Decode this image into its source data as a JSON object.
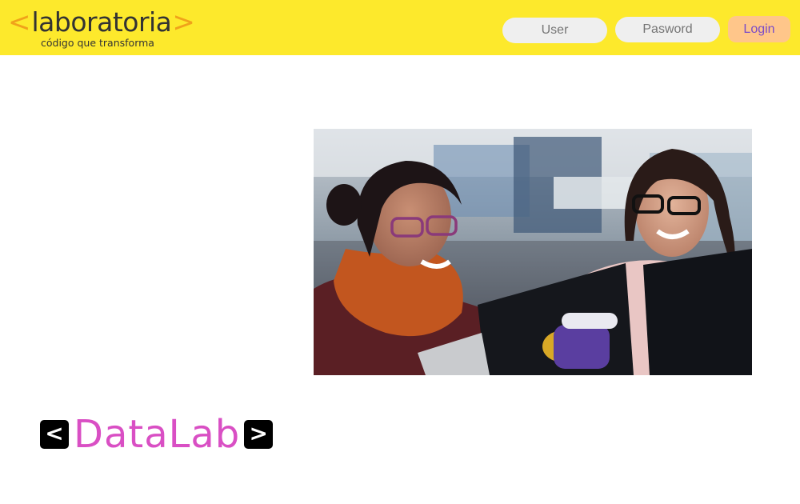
{
  "header": {
    "logo": {
      "bracket_open": "<",
      "wordmark": "laboratoria",
      "bracket_close": ">",
      "tagline": "código que transforma"
    },
    "login_form": {
      "user_placeholder": "User",
      "password_placeholder": "Pasword",
      "login_label": "Login"
    }
  },
  "hero": {
    "description": "photo"
  },
  "brand": {
    "prev_arrow": "<",
    "title": "DataLab",
    "next_arrow": ">"
  },
  "colors": {
    "header_bg": "#fde92c",
    "bracket": "#f0a21a",
    "login_bg": "#ffc68a",
    "login_text": "#7a4bc8",
    "datalab": "#d94fc4"
  }
}
